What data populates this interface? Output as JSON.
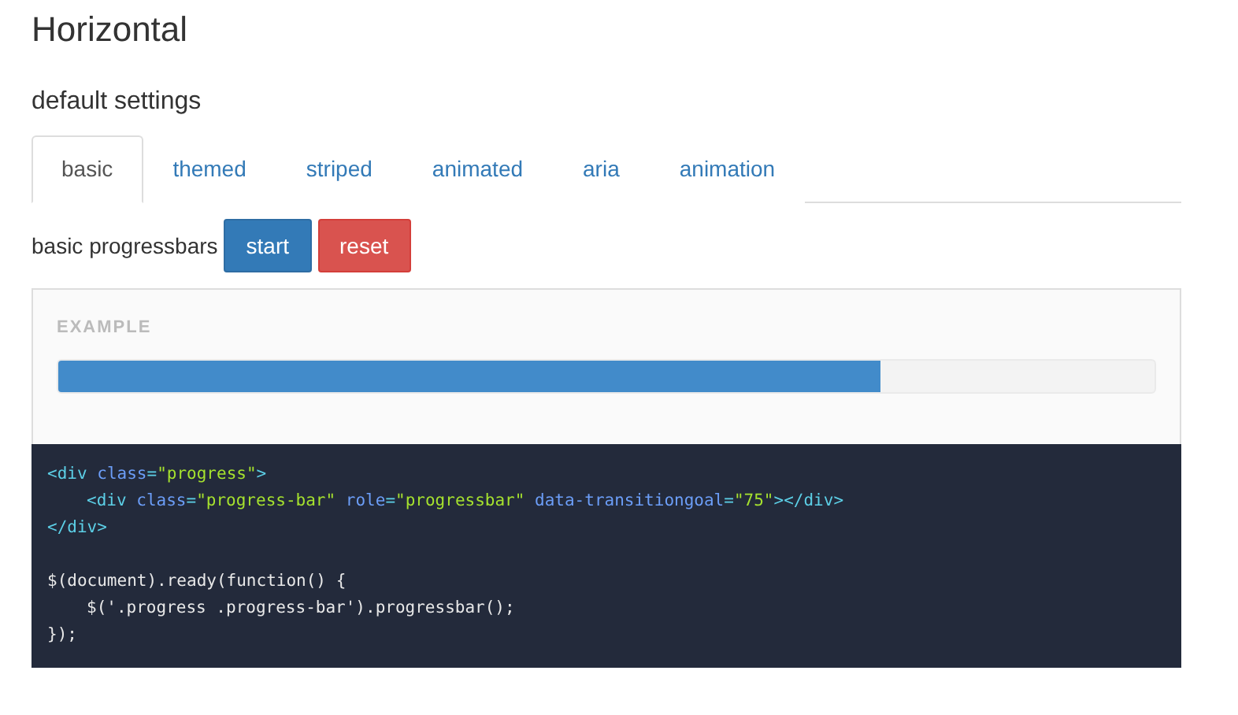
{
  "title": "Horizontal",
  "subtitle": "default settings",
  "tabs": [
    {
      "label": "basic",
      "selected": true
    },
    {
      "label": "themed",
      "selected": false
    },
    {
      "label": "striped",
      "selected": false
    },
    {
      "label": "animated",
      "selected": false
    },
    {
      "label": "aria",
      "selected": false
    },
    {
      "label": "animation",
      "selected": false
    }
  ],
  "controls": {
    "label": "basic progressbars",
    "buttons": [
      {
        "label": "start",
        "kind": "primary"
      },
      {
        "label": "reset",
        "kind": "danger"
      }
    ]
  },
  "example": {
    "heading": "EXAMPLE",
    "progress": {
      "level": 0.75
    }
  },
  "code_blocks": [
    [
      {
        "indented": false,
        "tokens": [
          {
            "kind": "tag",
            "text": "<div"
          },
          {
            "kind": "attr",
            "text": " class"
          },
          {
            "kind": "tag",
            "text": "="
          },
          {
            "kind": "string",
            "text": "\"progress\""
          },
          {
            "kind": "tag",
            "text": ">"
          }
        ]
      },
      {
        "indented": true,
        "tokens": [
          {
            "kind": "tag",
            "text": "<div"
          },
          {
            "kind": "attr",
            "text": " class"
          },
          {
            "kind": "tag",
            "text": "="
          },
          {
            "kind": "string",
            "text": "\"progress-bar\""
          },
          {
            "kind": "attr",
            "text": " role"
          },
          {
            "kind": "tag",
            "text": "="
          },
          {
            "kind": "string",
            "text": "\"progressbar\""
          },
          {
            "kind": "attr",
            "text": " data-transitiongoal"
          },
          {
            "kind": "tag",
            "text": "="
          },
          {
            "kind": "string",
            "text": "\"75\""
          },
          {
            "kind": "tag",
            "text": "></div>"
          }
        ]
      },
      {
        "indented": false,
        "tokens": [
          {
            "kind": "tag",
            "text": "</div>"
          }
        ]
      }
    ],
    [
      {
        "indented": false,
        "tokens": [
          {
            "kind": "plain",
            "text": "$(document).ready(function() {"
          }
        ]
      },
      {
        "indented": true,
        "tokens": [
          {
            "kind": "plain",
            "text": "$('.progress .progress-bar').progressbar();"
          }
        ]
      },
      {
        "indented": false,
        "tokens": [
          {
            "kind": "plain",
            "text": "});"
          }
        ]
      }
    ]
  ]
}
